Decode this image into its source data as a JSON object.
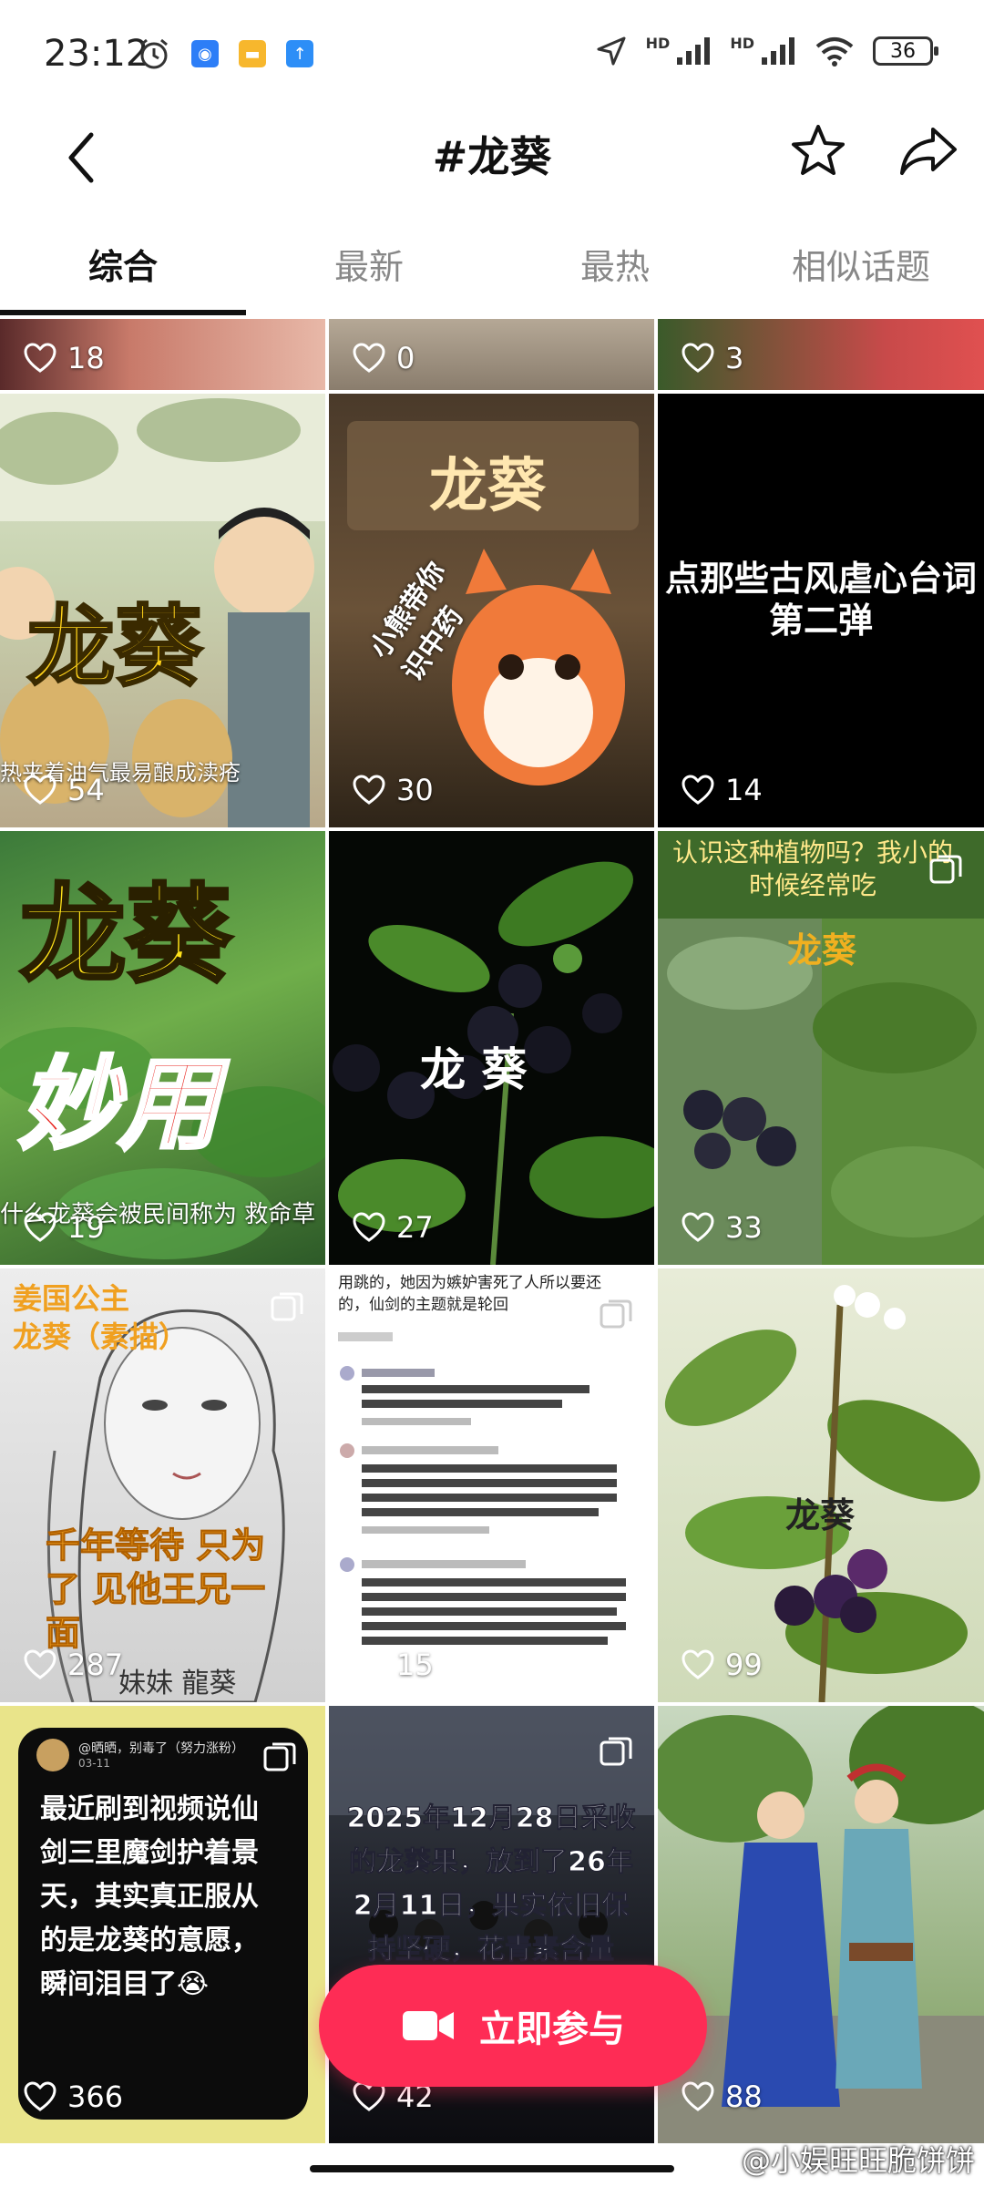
{
  "status": {
    "time": "23:12",
    "hd1": "HD",
    "hd2": "HD",
    "battery": "36"
  },
  "header": {
    "title": "#龙葵"
  },
  "tabs": [
    {
      "label": "综合",
      "active": true
    },
    {
      "label": "最新",
      "active": false
    },
    {
      "label": "最热",
      "active": false
    },
    {
      "label": "相似话题",
      "active": false
    }
  ],
  "grid": {
    "top_row_likes": [
      "18",
      "0",
      "3"
    ],
    "items": [
      {
        "likes": "54",
        "overlay": "龙葵",
        "caption": "热夹着油气最易酿成渎疮"
      },
      {
        "likes": "30",
        "overlay": "龙葵",
        "sticker": "小熊带你识中药"
      },
      {
        "likes": "14",
        "overlay": "点那些古风虐心台词第二弹"
      },
      {
        "likes": "19",
        "overlay": "龙葵",
        "overlay2": "妙用",
        "caption": "什么龙葵会被民间称为 救命草"
      },
      {
        "likes": "27",
        "overlay": "龙 葵"
      },
      {
        "likes": "33",
        "overlay": "认识这种植物吗？我小的时候经常吃",
        "overlay2": "龙葵"
      },
      {
        "likes": "287",
        "overlay": "姜国公主",
        "overlay2": "龙葵（素描）",
        "overlay3": "千年等待 只为了 见他王兄一面",
        "caption": "妹妹 龍葵"
      },
      {
        "likes": "15",
        "overlay": "用跳的，她因为嫉妒害死了人所以要还的，仙剑的主题就是轮回"
      },
      {
        "likes": "99",
        "overlay": "龙葵"
      },
      {
        "likes": "366",
        "author": "@晒晒，别毒了（努力涨粉）",
        "date": "03-11",
        "overlay": "最近刷到视频说仙剑三里魔剑护着景天，其实真正服从的是龙葵的意愿，瞬间泪目了😭"
      },
      {
        "likes": "42",
        "overlay": "2025年12月28日采收的龙葵果，放到了26年2月11日，果实依旧保持坚硬，花青素含量高，并"
      },
      {
        "likes": "88"
      }
    ]
  },
  "join_button": {
    "label": "立即参与"
  },
  "watermark": "@小娱旺旺脆饼饼",
  "colors": {
    "accent": "#fe2c55",
    "tab_active": "#111111",
    "tab_inactive": "#888888"
  },
  "icons": [
    "back-arrow-icon",
    "star-icon",
    "share-icon",
    "heart-icon",
    "video-camera-icon",
    "multi-image-icon"
  ]
}
